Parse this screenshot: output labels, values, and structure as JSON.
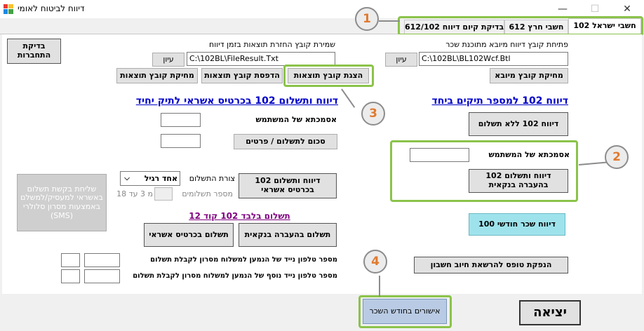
{
  "window": {
    "title": "דיווח לביטוח לאומי",
    "minimize": "—",
    "maximize": "☐",
    "close": "✕"
  },
  "tabs": [
    {
      "label": "102 חשבי ישראל"
    },
    {
      "label": "612 חשבי חרץ"
    },
    {
      "label": "בדיקת קיום דיווח 612/102"
    }
  ],
  "left_top": {
    "check_connection": "בדיקת התחברות",
    "save_label": "שמירת קובץ החזרת תוצאות בזמן דיווח",
    "browse": "עיון",
    "result_path": "C:\\102BL\\FileResult.Txt",
    "delete_results": "מחיקת קובץ תוצאות",
    "print_results": "הדפסת קובץ תוצאות",
    "show_results": "הצגת קובץ תוצאות"
  },
  "right_top": {
    "open_label": "פתיחת קובץ דיווח מיובא מתוכנת שכר",
    "browse": "עיון",
    "import_path": "C:\\102BL\\BL102Wcf.Btl",
    "delete_import": "מחיקת קובץ מיובא"
  },
  "credit_section": {
    "heading": "דיווח ותשלום 102 בכרטיס אשראי לתיק יחיד",
    "user_ref_label": "אסמכתא של המשתמש",
    "amount_button": "סכום לתשלום / פרטים",
    "report_credit_button": "דיווח ותשלום 102 בכרטיס אשראי",
    "payment_form_label": "צורת התשלום",
    "payment_form_value": "אחד רגיל",
    "installments_label": "מספר תשלומים",
    "installments_hint": "מ 3 עד 18",
    "sms_button": "שליחת בקשת תשלום באשראי למעסיק/למשלם באמצעות מסרון סלולרי (SMS)"
  },
  "payment_only": {
    "heading": "תשלום בלבד 102 קוד 12",
    "bank_transfer": "תשלום בהעברה בנקאית",
    "credit_card": "תשלום בכרטיס אשראי",
    "phone_label": "מספר טלפון נייד של הנמען למשלוח מסרון לקבלת תשלום",
    "phone2_label": "מספר טלפון נייד נוסף של הנמען למשלוח מסרון לקבלת תשלום"
  },
  "personal_file": {
    "heading": "דיווח 102 למספר תיקים ביחד",
    "no_payment_button": "דיווח 102 ללא תשלום",
    "user_ref_label": "אסמכתא של המשתמש",
    "bank_report_button": "דיווח ותשלום 102 בהעברה בנקאית",
    "monthly_salary_button": "דיווח שכר חודשי 100",
    "debit_form_button": "הנפקת טופס להרשאת חיוב חשבון"
  },
  "bottom": {
    "approvals_button": "אישורים בחודש השכר",
    "exit_button": "יציאה"
  },
  "callouts": [
    "1",
    "2",
    "3",
    "4"
  ],
  "colors": {
    "highlight": "#8bc34a",
    "heading_blue": "#0000c8",
    "heading_purple": "#800080",
    "monthly_button": "#9ee3ec",
    "approvals_button": "#b9cbe4",
    "callout_number": "#e07a2f"
  }
}
